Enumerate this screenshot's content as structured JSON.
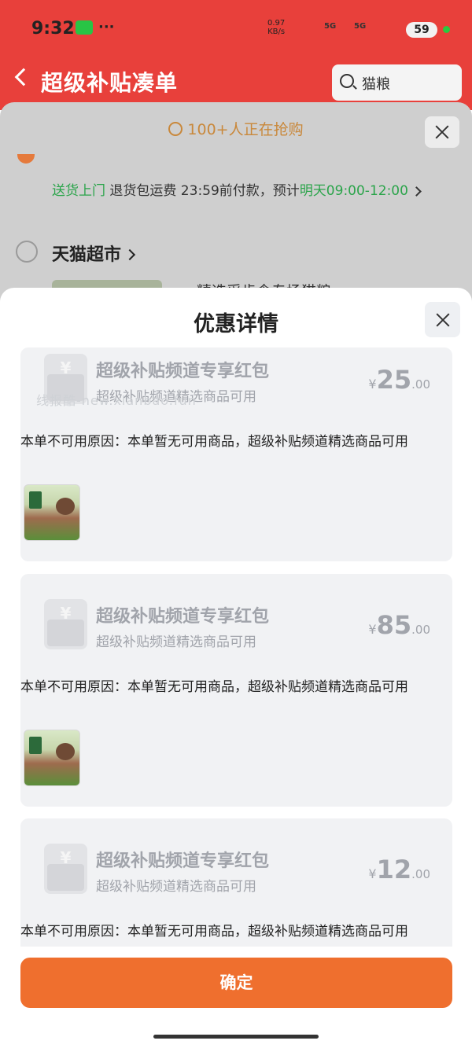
{
  "status_bar": {
    "time": "9:32",
    "dots": "···",
    "net_speed": "0.97",
    "net_unit": "KB/s",
    "signal1": "5G",
    "signal2": "5G",
    "battery": "59"
  },
  "header": {
    "title": "超级补贴凑单",
    "search_text": "猫粮"
  },
  "background": {
    "promo_text": "100+人正在抢购",
    "delivery_green": "送货上门",
    "delivery_text": "退货包运费  23:59前付款，预计",
    "delivery_eta": "明天09:00-12:00",
    "store_name": "天猫超市",
    "product_partial": "精选采齿食专场猫粮"
  },
  "modal": {
    "title": "优惠详情",
    "watermark": "线报酷-new.xianbao.fun",
    "confirm_label": "确定",
    "coupons": [
      {
        "title": "超级补贴频道专享红包",
        "subtitle": "超级补贴频道精选商品可用",
        "currency": "¥",
        "amount_int": "25",
        "amount_dec": ".00",
        "reason": "本单不可用原因：本单暂无可用商品，超级补贴频道精选商品可用"
      },
      {
        "title": "超级补贴频道专享红包",
        "subtitle": "超级补贴频道精选商品可用",
        "currency": "¥",
        "amount_int": "85",
        "amount_dec": ".00",
        "reason": "本单不可用原因：本单暂无可用商品，超级补贴频道精选商品可用"
      },
      {
        "title": "超级补贴频道专享红包",
        "subtitle": "超级补贴频道精选商品可用",
        "currency": "¥",
        "amount_int": "12",
        "amount_dec": ".00",
        "reason": "本单不可用原因：本单暂无可用商品，超级补贴频道精选商品可用"
      }
    ]
  }
}
